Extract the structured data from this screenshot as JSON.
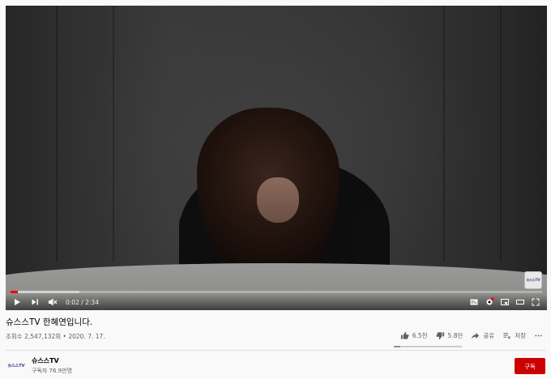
{
  "player": {
    "time_display": "0:02 / 2:34",
    "progress_played": 0.013,
    "progress_loaded": 0.13,
    "watermark_text": "슈스스TV"
  },
  "video": {
    "title": "슈스스TV 한혜연입니다.",
    "views": "조회수 2,547,132회",
    "date": "2020. 7. 17.",
    "like_count": "6.5천",
    "dislike_count": "5.8만",
    "share_label": "공유",
    "save_label": "저장",
    "like_ratio": 0.1
  },
  "channel": {
    "name": "슈스스TV",
    "subscribers": "구독자 76.9만명",
    "avatar_text": "슈스스TV",
    "subscribe_label": "구독"
  },
  "colors": {
    "subscribe": "#cc0000",
    "progress": "#ff0000"
  }
}
